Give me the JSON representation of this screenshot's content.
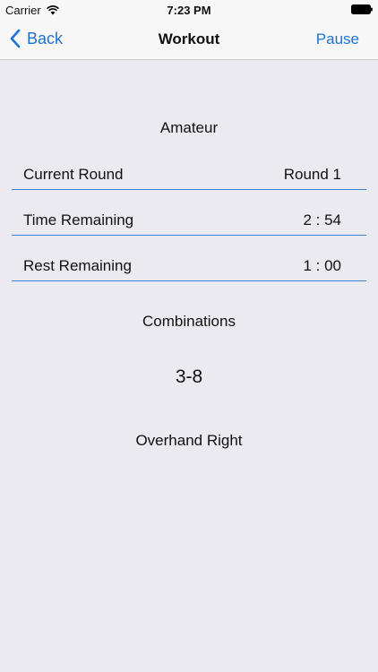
{
  "status_bar": {
    "carrier": "Carrier",
    "time": "7:23 PM",
    "wifi_icon": "wifi-icon",
    "battery_icon": "battery-icon"
  },
  "nav": {
    "back_label": "Back",
    "title": "Workout",
    "pause_label": "Pause"
  },
  "workout": {
    "level": "Amateur",
    "rows": [
      {
        "label": "Current Round",
        "value": "Round 1"
      },
      {
        "label": "Time Remaining",
        "value": "2 : 54"
      },
      {
        "label": "Rest Remaining",
        "value": "1 : 00"
      }
    ],
    "combinations_title": "Combinations",
    "combination_code": "3-8",
    "combination_name": "Overhand Right"
  },
  "colors": {
    "accent": "#1a73d9",
    "background": "#eaeaf0",
    "divider": "#3b82d6"
  }
}
